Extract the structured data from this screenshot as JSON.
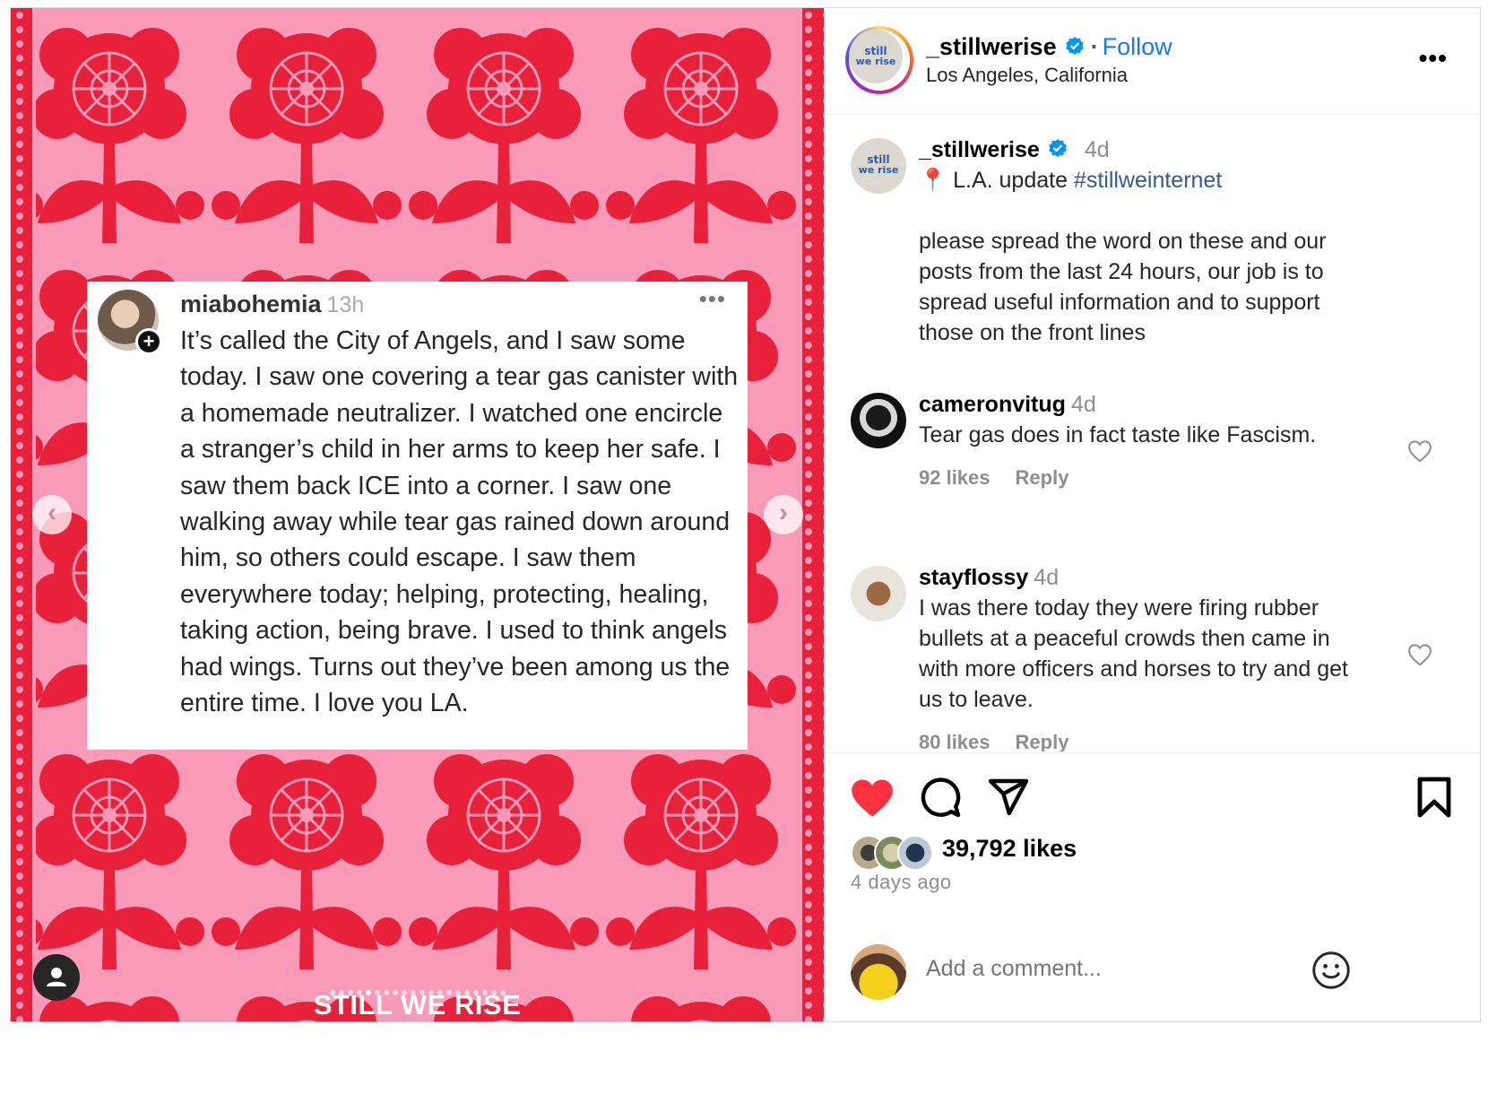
{
  "post": {
    "author": "_stillwerise",
    "follow_label": "Follow",
    "location": "Los Angeles, California",
    "logo_line1": "still",
    "logo_line2": "we rise",
    "more_label": "•••"
  },
  "media": {
    "card_user": "miabohemia",
    "card_time": "13h",
    "card_more": "•••",
    "card_plus": "+",
    "card_text": "It’s called the City of Angels, and I saw some today. I saw one covering a tear gas canister with a homemade neutralizer. I watched one encircle a stranger’s child in her arms to keep her safe. I saw them back ICE into a corner. I saw one walking away while tear gas rained down around him, so others could escape. I saw them everywhere today; helping, protecting, healing, taking action, being brave. I used to think angels had wings. Turns out they’ve been among us the entire time. I love you LA.",
    "prev_label": "‹",
    "next_label": "›",
    "watermark": "STILL WE RISE"
  },
  "caption": {
    "user": "_stillwerise",
    "time": "4d",
    "pin": "📍",
    "line1": "L.A. update ",
    "hashtag": "#stillweinternet",
    "text": "please spread the word on these and our posts from the last 24 hours, our job is to spread useful information and to support those on the front lines"
  },
  "comments": [
    {
      "user": "cameronvitug",
      "time": "4d",
      "text": "Tear gas does in fact taste like Fascism.",
      "likes": "92 likes",
      "reply": "Reply"
    },
    {
      "user": "stayflossy",
      "time": "4d",
      "text": "I was there today they were firing rubber bullets at a peaceful crowds then came in with more officers and horses to try and get us to leave.",
      "likes": "80 likes",
      "reply": "Reply"
    }
  ],
  "stats": {
    "likes": "39,792 likes",
    "date": "4 days ago",
    "liked": true
  },
  "add_comment": {
    "placeholder": "Add a comment..."
  },
  "colors": {
    "accent": "#1877f2",
    "like_red": "#ff3040",
    "pattern_pink": "#f89ab8",
    "pattern_red": "#e8203a"
  }
}
